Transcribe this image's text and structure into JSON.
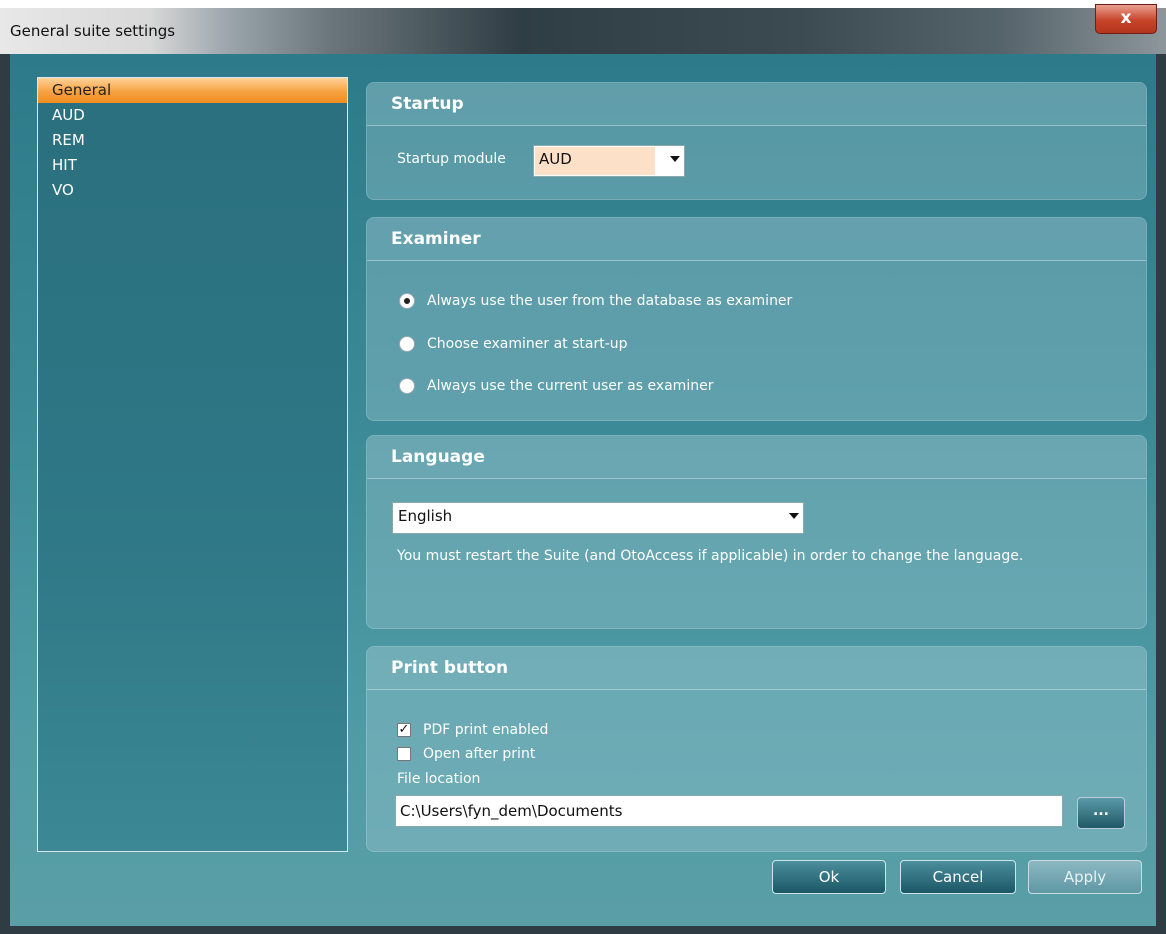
{
  "window": {
    "title": "General suite settings",
    "close_label": "x"
  },
  "nav": {
    "items": [
      {
        "label": "General",
        "selected": true
      },
      {
        "label": "AUD"
      },
      {
        "label": "REM"
      },
      {
        "label": "HIT"
      },
      {
        "label": "VO"
      }
    ]
  },
  "startup": {
    "header": "Startup",
    "module_label": "Startup module",
    "module_value": "AUD"
  },
  "examiner": {
    "header": "Examiner",
    "options": [
      {
        "label": "Always use the user from the database as examiner",
        "checked": true
      },
      {
        "label": "Choose examiner at start-up",
        "checked": false
      },
      {
        "label": "Always use the current user as examiner",
        "checked": false
      }
    ]
  },
  "language": {
    "header": "Language",
    "value": "English",
    "note": "You must restart the Suite (and OtoAccess if applicable) in order to change the language."
  },
  "print": {
    "header": "Print button",
    "pdf_label": "PDF print enabled",
    "pdf_checked": true,
    "open_label": "Open after print",
    "open_checked": false,
    "file_location_label": "File location",
    "file_location_value": "C:\\Users\\fyn_dem\\Documents",
    "browse_label": "..."
  },
  "buttons": {
    "ok": "Ok",
    "cancel": "Cancel",
    "apply": "Apply"
  }
}
